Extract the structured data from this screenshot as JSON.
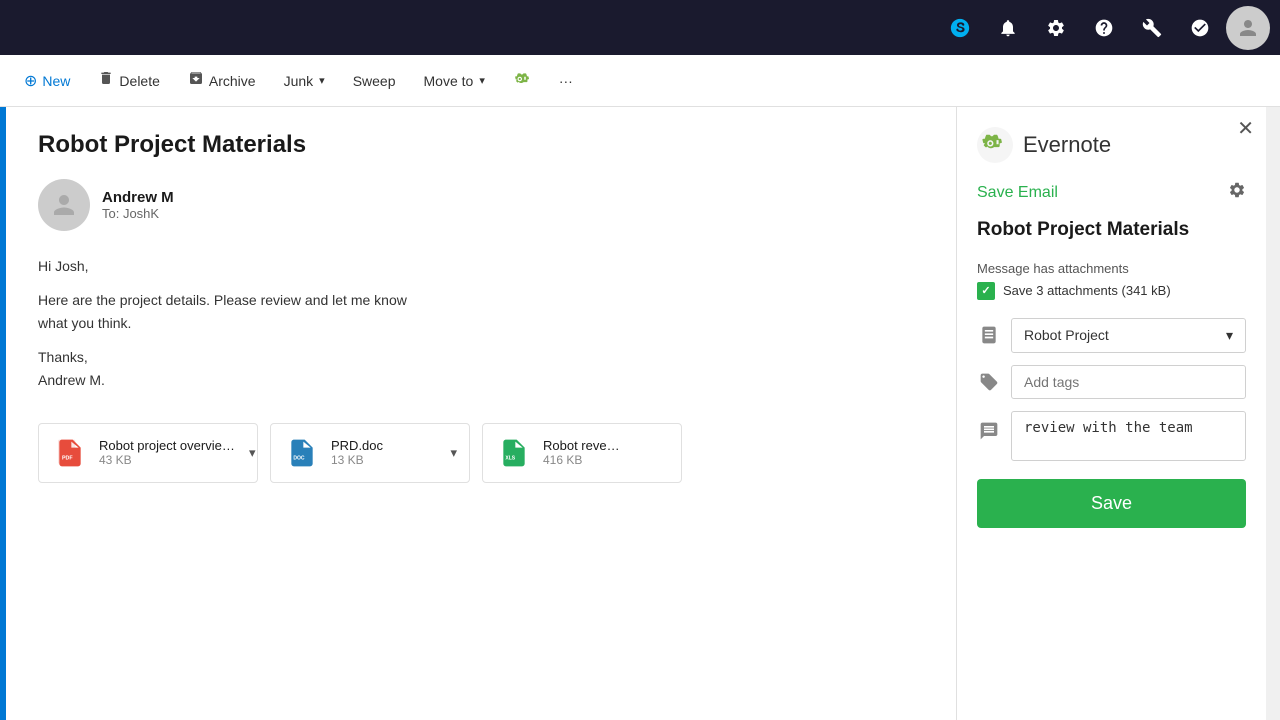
{
  "topnav": {
    "icons": [
      {
        "name": "skype-icon",
        "symbol": "S",
        "title": "Skype"
      },
      {
        "name": "bell-icon",
        "symbol": "🔔",
        "title": "Notifications"
      },
      {
        "name": "gear-icon",
        "symbol": "⚙",
        "title": "Settings"
      },
      {
        "name": "help-icon",
        "symbol": "?",
        "title": "Help"
      },
      {
        "name": "wrench-icon",
        "symbol": "🔧",
        "title": "Tools"
      },
      {
        "name": "face-icon",
        "symbol": "☺",
        "title": "Feedback"
      },
      {
        "name": "avatar-icon",
        "symbol": "👤",
        "title": "Profile"
      }
    ]
  },
  "toolbar": {
    "buttons": [
      {
        "name": "new-button",
        "label": "New",
        "icon": "⊕",
        "hasDropdown": false
      },
      {
        "name": "delete-button",
        "label": "Delete",
        "icon": "🗑",
        "hasDropdown": false
      },
      {
        "name": "archive-button",
        "label": "Archive",
        "icon": "📦",
        "hasDropdown": false
      },
      {
        "name": "junk-button",
        "label": "Junk",
        "icon": "",
        "hasDropdown": true
      },
      {
        "name": "sweep-button",
        "label": "Sweep",
        "icon": "",
        "hasDropdown": false
      },
      {
        "name": "moveto-button",
        "label": "Move to",
        "icon": "",
        "hasDropdown": true
      },
      {
        "name": "evernote-button",
        "label": "",
        "icon": "",
        "hasDropdown": false
      },
      {
        "name": "more-button",
        "label": "···",
        "icon": "",
        "hasDropdown": false
      }
    ]
  },
  "email": {
    "subject": "Robot Project Materials",
    "sender": {
      "name": "Andrew M",
      "to": "To: JoshK"
    },
    "body": [
      "Hi Josh,",
      "Here are the project details. Please review and let me know what you think.",
      "Thanks,\nAndrew M."
    ],
    "attachments": [
      {
        "name": "Robot project overview.pdf",
        "size": "43 KB",
        "type": "pdf"
      },
      {
        "name": "PRD.doc",
        "size": "13 KB",
        "type": "doc"
      },
      {
        "name": "Robot reve…",
        "size": "416 KB",
        "type": "xls"
      }
    ]
  },
  "evernote_panel": {
    "title": "Evernote",
    "save_email_label": "Save Email",
    "note_title": "Robot Project Materials",
    "attachments_section": {
      "label": "Message has attachments",
      "checkbox_label": "Save 3 attachments (341 kB)"
    },
    "notebook": {
      "label": "Robot Project",
      "placeholder": "Robot Project"
    },
    "tags": {
      "placeholder": "Add tags"
    },
    "remark": {
      "value": "review with the team"
    },
    "save_button": "Save"
  }
}
